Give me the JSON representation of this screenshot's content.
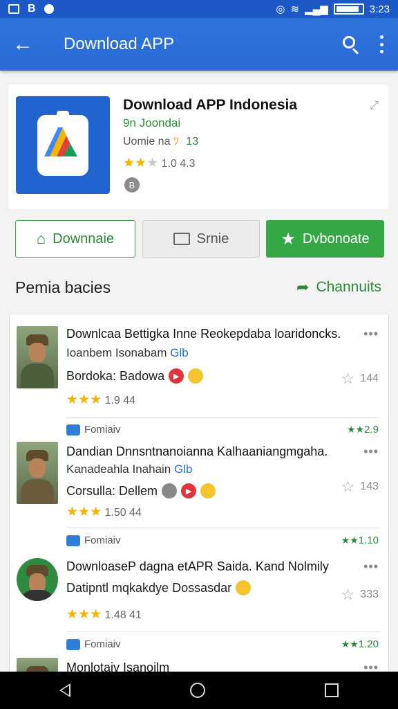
{
  "status_bar": {
    "time": "3:23",
    "icons": [
      "image-icon",
      "b-icon",
      "dot-icon",
      "vibrate-icon",
      "wifi-icon",
      "signal-icon",
      "battery-icon"
    ]
  },
  "app_bar": {
    "title": "Download APP",
    "back_icon": "arrow-left-icon",
    "search_icon": "search-icon",
    "more_icon": "more-vert-icon",
    "color": "#2a6ad6"
  },
  "app_card": {
    "title": "Download APP Indonesia",
    "developer": "9n Joondai",
    "meta": "Uomie na",
    "meta_count": "13",
    "rating_text": "1.0 4.3",
    "rating": 2
  },
  "buttons": {
    "install": "Downnaie",
    "share": "Srnie",
    "favorite": "Dvbonoate"
  },
  "section": {
    "title": "Pemia bacies",
    "link": "Channuits"
  },
  "items": [
    {
      "title": "Downlcaa Bettigka Inne Reokepdaba loaridoncks.",
      "sub": "Ioanbem Isonabam",
      "sub_tag": "Glb",
      "desc": "Bordoka: Badowa",
      "stars": 3,
      "rating_text": "1.9 44",
      "fav_count": "144",
      "tag_label": "",
      "score": ""
    },
    {
      "title": "Dandian Dnnsntnanoianna Kalhaaniangmgaha.",
      "sub": "Kanadeahla Inahain",
      "sub_tag": "Glb",
      "desc": "Corsulla: Dellem",
      "stars": 2.5,
      "rating_text": "1.50 44",
      "fav_count": "143",
      "tag_label": "Fomiaiv",
      "score": "2.9"
    },
    {
      "title": "DownloaseP dagna etAPR Saida. Kand Nolmily",
      "sub": "",
      "sub_tag": "",
      "desc": "Datipntl mqkakdye Dossasdar",
      "stars": 3,
      "rating_text": "1.48 41",
      "fav_count": "333",
      "tag_label": "Fomiaiv",
      "score": "1.10"
    },
    {
      "title": "Monlotaiv Isanoilm",
      "sub": "",
      "sub_tag": "",
      "desc": "",
      "stars": 0,
      "rating_text": "",
      "fav_count": "",
      "tag_label": "Fomiaiv",
      "score": "1.20"
    }
  ],
  "accent": "#35a845",
  "primary": "#1c59c7"
}
